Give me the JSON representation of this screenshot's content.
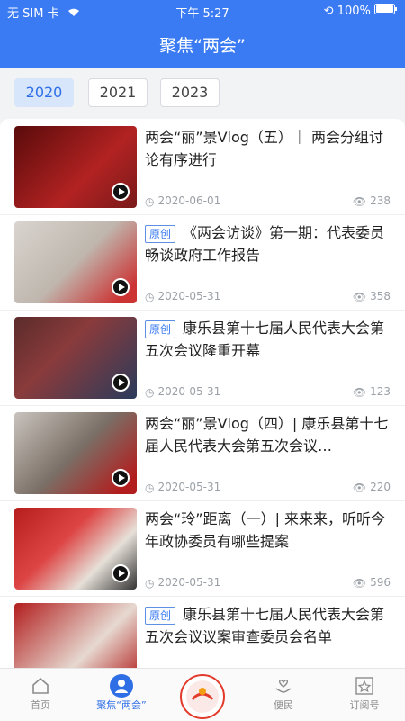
{
  "status": {
    "carrier": "无 SIM 卡",
    "time": "下午 5:27",
    "battery": "100%"
  },
  "header": {
    "title": "聚焦“两会”"
  },
  "years": [
    "2020",
    "2021",
    "2023"
  ],
  "items": [
    {
      "title": "两会“丽”景Vlog（五）｜ 两会分组讨论有序进行",
      "tag": "",
      "date": "2020-06-01",
      "views": "238"
    },
    {
      "title": "《两会访谈》第一期：代表委员畅谈政府工作报告",
      "tag": "原创",
      "date": "2020-05-31",
      "views": "358"
    },
    {
      "title": "康乐县第十七届人民代表大会第五次会议隆重开幕",
      "tag": "原创",
      "date": "2020-05-31",
      "views": "123"
    },
    {
      "title": "两会“丽”景Vlog（四）| 康乐县第十七届人民代表大会第五次会议…",
      "tag": "",
      "date": "2020-05-31",
      "views": "220"
    },
    {
      "title": "两会“玲”距离（一）| 来来来，听听今年政协委员有哪些提案",
      "tag": "",
      "date": "2020-05-31",
      "views": "596"
    },
    {
      "title": "康乐县第十七届人民代表大会第五次会议议案审查委员会名单",
      "tag": "原创",
      "date": "",
      "views": ""
    }
  ],
  "tabs": {
    "home": "首页",
    "focus": "聚焦“两会”",
    "service": "便民",
    "subscribe": "订阅号"
  },
  "colors": {
    "primary": "#3a7bf3"
  }
}
